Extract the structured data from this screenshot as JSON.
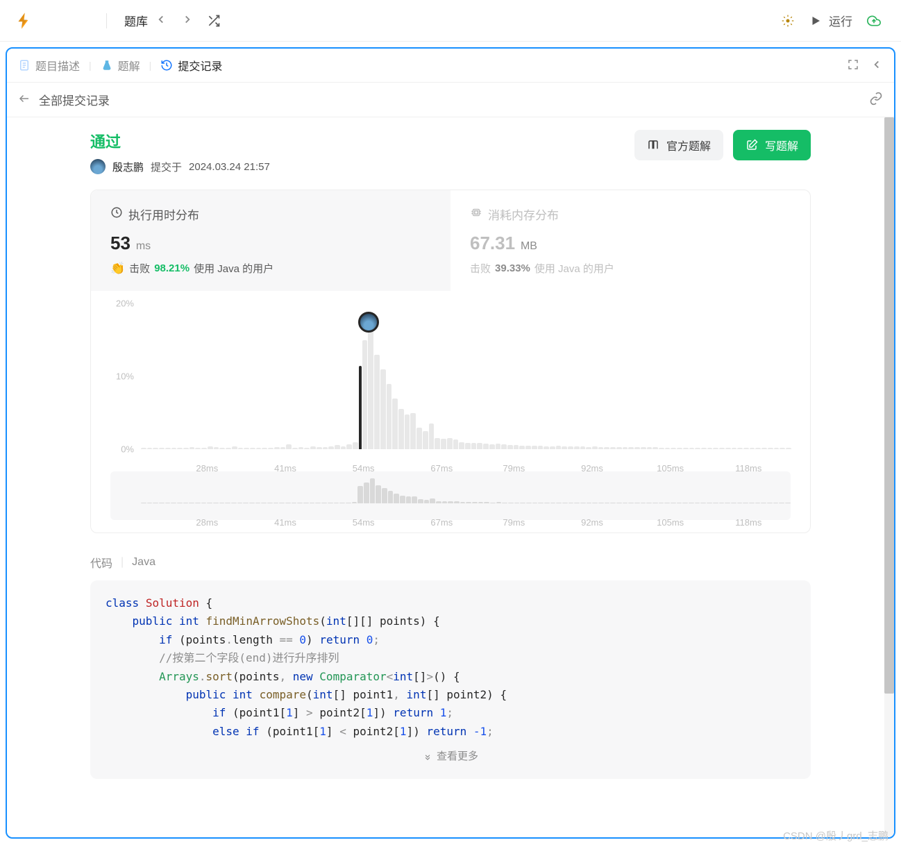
{
  "toolbar": {
    "problem_set": "题库",
    "run": "运行"
  },
  "tabs": {
    "description": "题目描述",
    "solutions": "题解",
    "submissions": "提交记录"
  },
  "subheader": {
    "title": "全部提交记录"
  },
  "status": {
    "label": "通过",
    "user": "殷志鹏",
    "submitted_prefix": "提交于",
    "submitted_at": "2024.03.24 21:57"
  },
  "buttons": {
    "official_solution": "官方题解",
    "write_solution": "写题解"
  },
  "metrics": {
    "runtime": {
      "title": "执行用时分布",
      "value": "53",
      "unit": "ms",
      "beat_label": "击败",
      "beat_pct": "98.21%",
      "beat_suffix": "使用 Java 的用户"
    },
    "memory": {
      "title": "消耗内存分布",
      "value": "67.31",
      "unit": "MB",
      "beat_label": "击败",
      "beat_pct": "39.33%",
      "beat_suffix": "使用 Java 的用户"
    }
  },
  "chart_data": {
    "type": "bar",
    "title": "执行用时分布",
    "xlabel": "ms",
    "ylabel": "%",
    "ylim": [
      0,
      20
    ],
    "y_ticks": [
      "0%",
      "10%",
      "20%"
    ],
    "x_ticks": [
      "28ms",
      "41ms",
      "54ms",
      "67ms",
      "79ms",
      "92ms",
      "105ms",
      "118ms"
    ],
    "marker_x": 53,
    "series": [
      {
        "name": "runtime-distribution",
        "x_start": 17,
        "x_step": 1,
        "values": [
          0,
          0,
          0,
          0,
          0,
          0,
          0,
          0,
          0.3,
          0.2,
          0.2,
          0.4,
          0.3,
          0.2,
          0.2,
          0.4,
          0.2,
          0,
          0.2,
          0,
          0.2,
          0.2,
          0.3,
          0.3,
          0.7,
          0.2,
          0.3,
          0.2,
          0.4,
          0.3,
          0.3,
          0.4,
          0.6,
          0.4,
          0.7,
          1.0,
          12.5,
          15,
          18,
          13,
          11,
          9,
          7,
          5.5,
          4.8,
          5,
          3,
          2.5,
          3.5,
          1.5,
          1.4,
          1.5,
          1.3,
          1,
          0.9,
          0.9,
          0.9,
          0.8,
          0.7,
          0.8,
          0.7,
          0.6,
          0.6,
          0.5,
          0.5,
          0.5,
          0.5,
          0.4,
          0.4,
          0.5,
          0.4,
          0.4,
          0.4,
          0.4,
          0.3,
          0.4,
          0.3,
          0.3,
          0.3,
          0.3,
          0.3,
          0.3,
          0.3,
          0.3,
          0.3,
          0.3,
          0.2,
          0.2,
          0.2,
          0.2,
          0.2,
          0.2,
          0.2,
          0.2,
          0.2,
          0.2,
          0.2,
          0.2,
          0.2,
          0.2,
          0.2,
          0.2,
          0.2,
          0.1,
          0.2,
          0.1,
          0.2,
          0.1
        ]
      }
    ]
  },
  "code": {
    "label": "代码",
    "language": "Java",
    "show_more": "查看更多"
  },
  "watermark": "CSDN @殷丿grd_志鹏"
}
